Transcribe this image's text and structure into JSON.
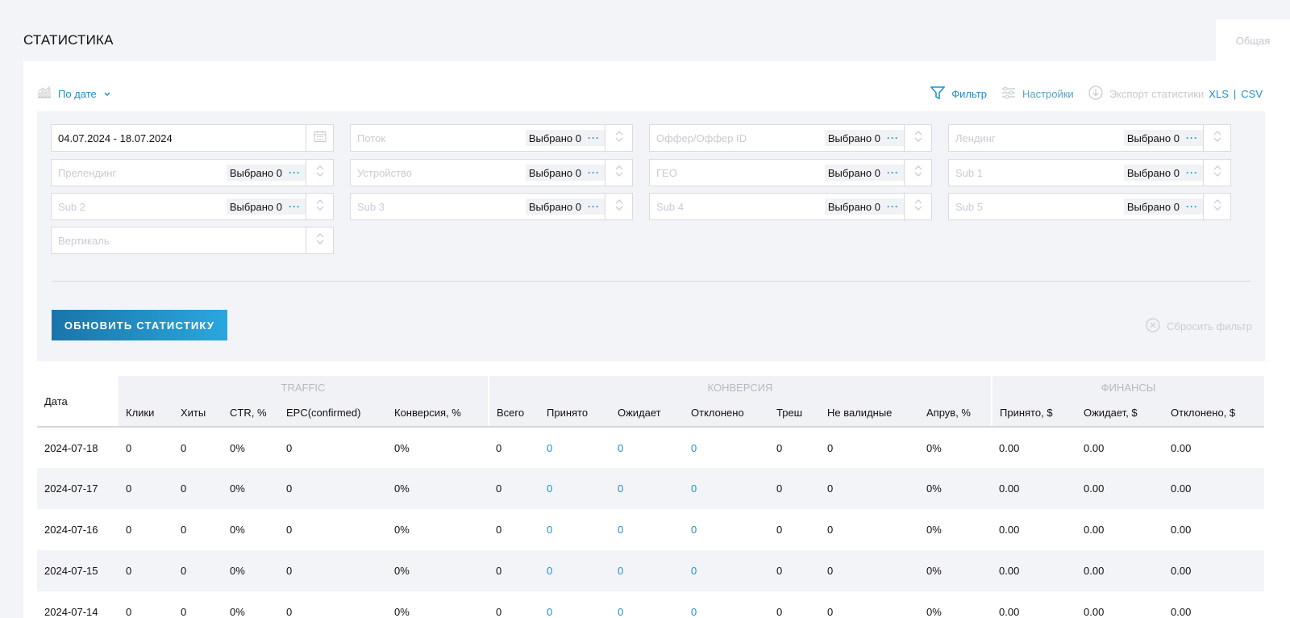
{
  "page": {
    "title": "СТАТИСТИКА",
    "tab_general": "Общая"
  },
  "toolbar": {
    "view": "По дате",
    "filter": "Фильтр",
    "settings": "Настройки",
    "export": "Экспорт статистики",
    "xls": "XLS",
    "sep": "|",
    "csv": "CSV"
  },
  "filters": {
    "date_range": "04.07.2024 - 18.07.2024",
    "chip_text": "Выбрано 0",
    "stream": "Поток",
    "offer": "Оффер/Оффер ID",
    "landing": "Лендинг",
    "prelanding": "Прелендинг",
    "device": "Устройство",
    "geo": "ГЕО",
    "sub1": "Sub 1",
    "sub2": "Sub 2",
    "sub3": "Sub 3",
    "sub4": "Sub 4",
    "sub5": "Sub 5",
    "vertical": "Вертикаль",
    "refresh": "ОБНОВИТЬ СТАТИСТИКУ",
    "reset": "Сбросить фильтр"
  },
  "table": {
    "groups": {
      "traffic": "TRAFFIC",
      "conversion": "КОНВЕРСИЯ",
      "finance": "ФИНАНСЫ"
    },
    "columns": [
      "Дата",
      "Клики",
      "Хиты",
      "CTR, %",
      "EPC(confirmed)",
      "Конверсия, %",
      "Всего",
      "Принято",
      "Ожидает",
      "Отклонено",
      "Треш",
      "Не валидные",
      "Апрув, %",
      "Принято, $",
      "Ожидает, $",
      "Отклонено, $"
    ],
    "rows": [
      [
        "2024-07-18",
        "0",
        "0",
        "0%",
        "0",
        "0%",
        "0",
        "0",
        "0",
        "0",
        "0",
        "0",
        "0%",
        "0.00",
        "0.00",
        "0.00"
      ],
      [
        "2024-07-17",
        "0",
        "0",
        "0%",
        "0",
        "0%",
        "0",
        "0",
        "0",
        "0",
        "0",
        "0",
        "0%",
        "0.00",
        "0.00",
        "0.00"
      ],
      [
        "2024-07-16",
        "0",
        "0",
        "0%",
        "0",
        "0%",
        "0",
        "0",
        "0",
        "0",
        "0",
        "0",
        "0%",
        "0.00",
        "0.00",
        "0.00"
      ],
      [
        "2024-07-15",
        "0",
        "0",
        "0%",
        "0",
        "0%",
        "0",
        "0",
        "0",
        "0",
        "0",
        "0",
        "0%",
        "0.00",
        "0.00",
        "0.00"
      ],
      [
        "2024-07-14",
        "0",
        "0",
        "0%",
        "0",
        "0%",
        "0",
        "0",
        "0",
        "0",
        "0",
        "0",
        "0%",
        "0.00",
        "0.00",
        "0.00"
      ]
    ]
  },
  "colors": {
    "accent": "#1f8fc7",
    "muted": "#c5c8cf",
    "panel": "#f3f4f8"
  }
}
